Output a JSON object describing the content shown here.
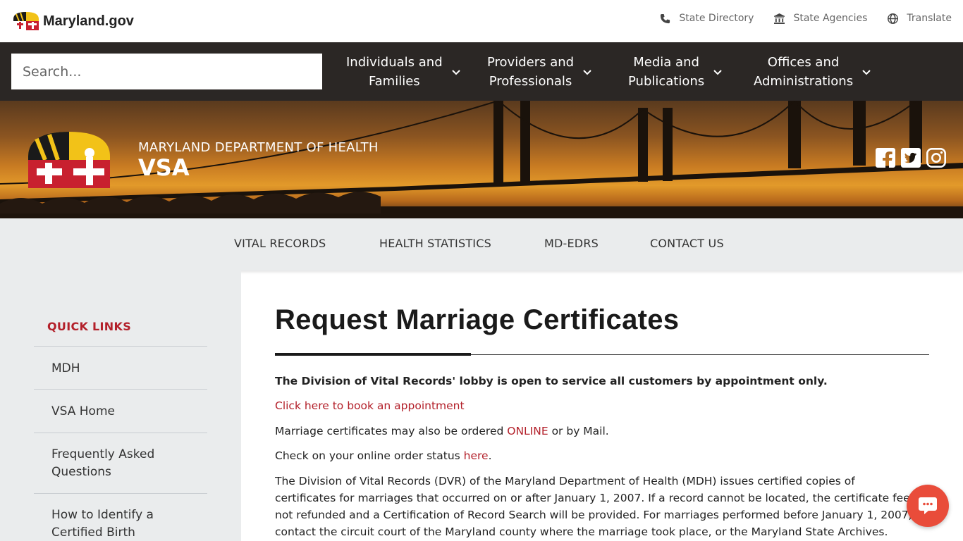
{
  "brand": {
    "name": "Maryland.gov"
  },
  "utility": [
    {
      "label": "State Directory",
      "icon": "phone-icon"
    },
    {
      "label": "State Agencies",
      "icon": "building-icon"
    },
    {
      "label": "Translate",
      "icon": "globe-icon"
    }
  ],
  "search": {
    "placeholder": "Search..."
  },
  "nav": [
    {
      "line1": "Individuals and",
      "line2": "Families"
    },
    {
      "line1": "Providers and",
      "line2": "Professionals"
    },
    {
      "line1": "Media and",
      "line2": "Publications"
    },
    {
      "line1": "Offices and",
      "line2": "Administrations"
    }
  ],
  "hero": {
    "subtitle": "MARYLAND DEPARTMENT OF HEALTH",
    "title": "VSA"
  },
  "social": [
    "facebook-icon",
    "twitter-icon",
    "instagram-icon"
  ],
  "subnav": [
    "VITAL RECORDS",
    "HEALTH STATISTICS",
    "MD-EDRS",
    "CONTACT US"
  ],
  "sidebar": {
    "title": "QUICK LINKS",
    "links": [
      {
        "line1": "MDH",
        "line2": ""
      },
      {
        "line1": "VSA Home",
        "line2": ""
      },
      {
        "line1": "Frequently Asked",
        "line2": "Questions"
      },
      {
        "line1": "How to Identify a",
        "line2": "Certified Birth"
      }
    ]
  },
  "content": {
    "title": "Request Marriage Certificates",
    "notice": "The Division of Vital Records' lobby is open to service all customers by appointment only.",
    "appointment_link": "Click here to book an appointment",
    "order_pre": "Marriage certificates may also be ordered ",
    "order_link": "ONLINE",
    "order_post": " or by Mail.",
    "status_pre": "Check on your online order status ",
    "status_link": "here",
    "status_post": ".",
    "paragraph": [
      "The Division of Vital Records (DVR) of the Maryland Department of Health (MDH) issues certified copies of",
      "certificates for marriages that occurred on or after January 1, 2007. If a record cannot be located, the certificate fee is",
      "not refunded and a Certification of Record Search will be provided. For marriages performed before January 1, 2007,",
      "contact the circuit court of the Maryland county where the marriage took place, or the Maryland State Archives."
    ]
  },
  "colors": {
    "accent": "#b3202a",
    "nav_bg": "#2b2725",
    "subnav_bg": "#eaeced",
    "chat": "#e94c3a"
  }
}
